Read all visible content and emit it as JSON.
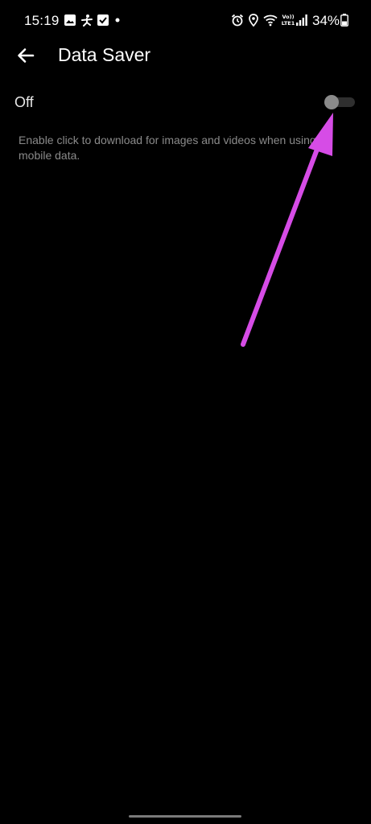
{
  "status_bar": {
    "time": "15:19",
    "volte_line1": "Vo))",
    "volte_line2": "LTE1",
    "battery_text": "34%",
    "icons": [
      "gallery-icon",
      "accessibility-icon",
      "checkbox-icon",
      "dot-icon",
      "alarm-icon",
      "location-icon",
      "wifi-icon",
      "signal-icon",
      "battery-icon"
    ]
  },
  "header": {
    "title": "Data Saver",
    "back_icon": "back-arrow-icon"
  },
  "setting": {
    "state_label": "Off",
    "toggle_on": false,
    "description": "Enable click to download for images and videos when using mobile data."
  },
  "annotation": {
    "color": "#d64ce6"
  },
  "colors": {
    "background": "#000000",
    "text_primary": "#ffffff",
    "text_secondary": "#8a8a8a",
    "toggle_thumb": "#8a8a8a",
    "toggle_track": "#2f2f2f"
  }
}
